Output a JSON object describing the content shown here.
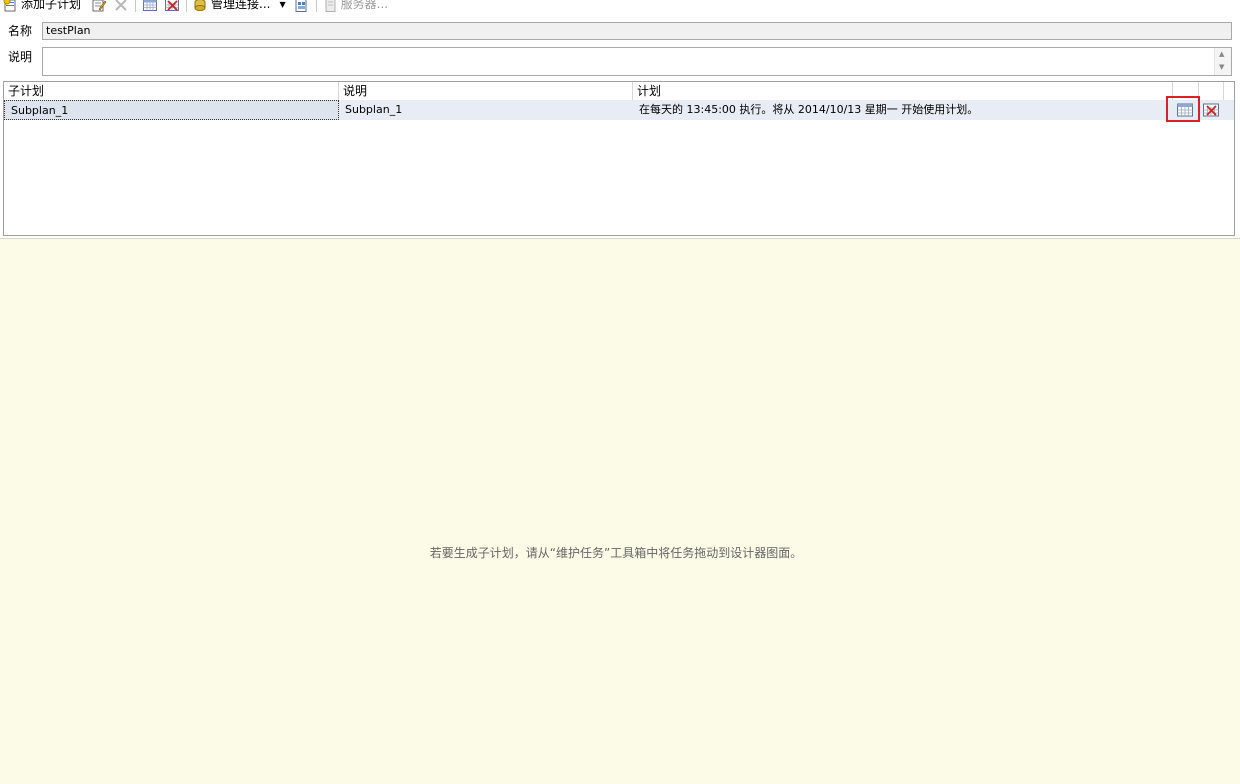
{
  "toolbar": {
    "add_subplan_label": "添加子计划",
    "manage_connections_label": "管理连接...",
    "server_label": "服务器...",
    "icons": {
      "add_subplan": "add-subplan-icon",
      "properties": "edit-properties-icon",
      "delete": "delete-icon",
      "schedule": "schedule-calendar-icon",
      "remove_schedule": "remove-schedule-icon",
      "connections": "manage-connections-icon",
      "reporting": "reporting-icon",
      "server": "server-icon"
    }
  },
  "form": {
    "name_label": "名称",
    "name_value": "testPlan",
    "description_label": "说明",
    "description_value": ""
  },
  "grid": {
    "columns": [
      "子计划",
      "说明",
      "计划"
    ],
    "rows": [
      {
        "subplan": "Subplan_1",
        "description": "Subplan_1",
        "schedule": "在每天的 13:45:00 执行。将从 2014/10/13 星期一 开始使用计划。"
      }
    ]
  },
  "designer": {
    "hint": "若要生成子计划，请从“维护任务”工具箱中将任务拖动到设计器图面。"
  },
  "colors": {
    "highlight": "#e02020",
    "designer_background": "#fcfbe8",
    "selected_row": "#e8edf5"
  }
}
